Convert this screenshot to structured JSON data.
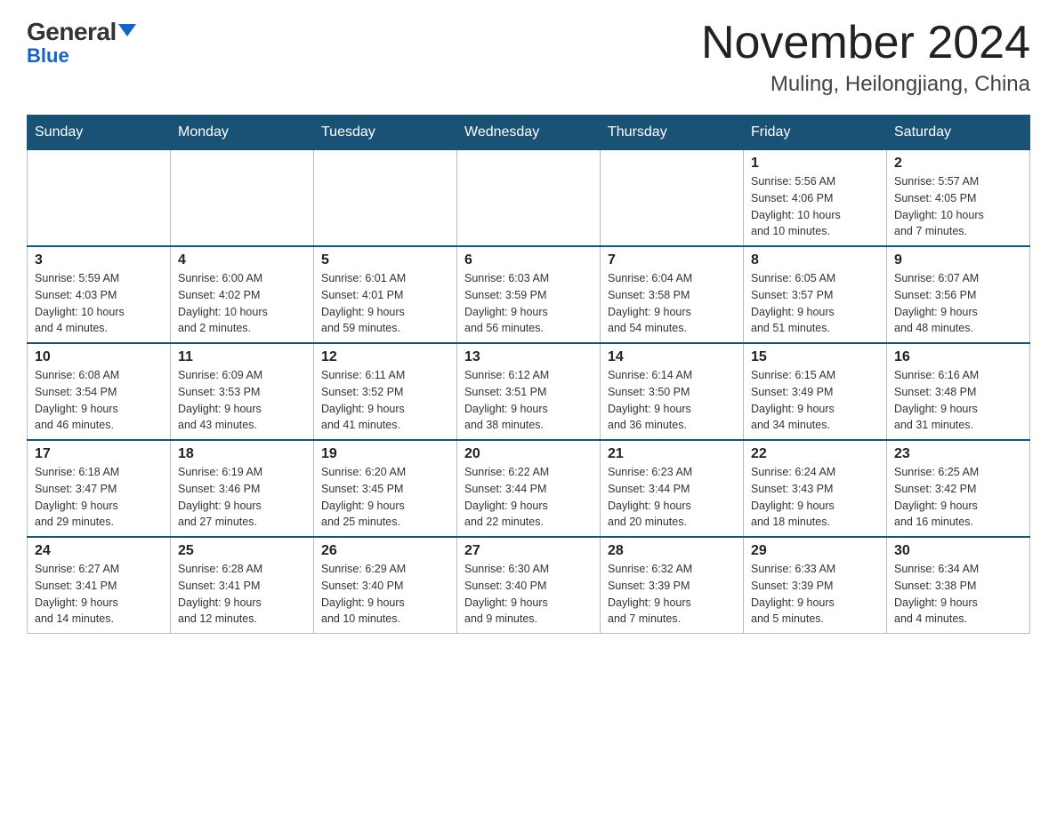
{
  "header": {
    "logo_top": "General",
    "logo_bottom": "Blue",
    "title": "November 2024",
    "subtitle": "Muling, Heilongjiang, China"
  },
  "weekdays": [
    "Sunday",
    "Monday",
    "Tuesday",
    "Wednesday",
    "Thursday",
    "Friday",
    "Saturday"
  ],
  "weeks": [
    [
      {
        "day": "",
        "info": ""
      },
      {
        "day": "",
        "info": ""
      },
      {
        "day": "",
        "info": ""
      },
      {
        "day": "",
        "info": ""
      },
      {
        "day": "",
        "info": ""
      },
      {
        "day": "1",
        "info": "Sunrise: 5:56 AM\nSunset: 4:06 PM\nDaylight: 10 hours\nand 10 minutes."
      },
      {
        "day": "2",
        "info": "Sunrise: 5:57 AM\nSunset: 4:05 PM\nDaylight: 10 hours\nand 7 minutes."
      }
    ],
    [
      {
        "day": "3",
        "info": "Sunrise: 5:59 AM\nSunset: 4:03 PM\nDaylight: 10 hours\nand 4 minutes."
      },
      {
        "day": "4",
        "info": "Sunrise: 6:00 AM\nSunset: 4:02 PM\nDaylight: 10 hours\nand 2 minutes."
      },
      {
        "day": "5",
        "info": "Sunrise: 6:01 AM\nSunset: 4:01 PM\nDaylight: 9 hours\nand 59 minutes."
      },
      {
        "day": "6",
        "info": "Sunrise: 6:03 AM\nSunset: 3:59 PM\nDaylight: 9 hours\nand 56 minutes."
      },
      {
        "day": "7",
        "info": "Sunrise: 6:04 AM\nSunset: 3:58 PM\nDaylight: 9 hours\nand 54 minutes."
      },
      {
        "day": "8",
        "info": "Sunrise: 6:05 AM\nSunset: 3:57 PM\nDaylight: 9 hours\nand 51 minutes."
      },
      {
        "day": "9",
        "info": "Sunrise: 6:07 AM\nSunset: 3:56 PM\nDaylight: 9 hours\nand 48 minutes."
      }
    ],
    [
      {
        "day": "10",
        "info": "Sunrise: 6:08 AM\nSunset: 3:54 PM\nDaylight: 9 hours\nand 46 minutes."
      },
      {
        "day": "11",
        "info": "Sunrise: 6:09 AM\nSunset: 3:53 PM\nDaylight: 9 hours\nand 43 minutes."
      },
      {
        "day": "12",
        "info": "Sunrise: 6:11 AM\nSunset: 3:52 PM\nDaylight: 9 hours\nand 41 minutes."
      },
      {
        "day": "13",
        "info": "Sunrise: 6:12 AM\nSunset: 3:51 PM\nDaylight: 9 hours\nand 38 minutes."
      },
      {
        "day": "14",
        "info": "Sunrise: 6:14 AM\nSunset: 3:50 PM\nDaylight: 9 hours\nand 36 minutes."
      },
      {
        "day": "15",
        "info": "Sunrise: 6:15 AM\nSunset: 3:49 PM\nDaylight: 9 hours\nand 34 minutes."
      },
      {
        "day": "16",
        "info": "Sunrise: 6:16 AM\nSunset: 3:48 PM\nDaylight: 9 hours\nand 31 minutes."
      }
    ],
    [
      {
        "day": "17",
        "info": "Sunrise: 6:18 AM\nSunset: 3:47 PM\nDaylight: 9 hours\nand 29 minutes."
      },
      {
        "day": "18",
        "info": "Sunrise: 6:19 AM\nSunset: 3:46 PM\nDaylight: 9 hours\nand 27 minutes."
      },
      {
        "day": "19",
        "info": "Sunrise: 6:20 AM\nSunset: 3:45 PM\nDaylight: 9 hours\nand 25 minutes."
      },
      {
        "day": "20",
        "info": "Sunrise: 6:22 AM\nSunset: 3:44 PM\nDaylight: 9 hours\nand 22 minutes."
      },
      {
        "day": "21",
        "info": "Sunrise: 6:23 AM\nSunset: 3:44 PM\nDaylight: 9 hours\nand 20 minutes."
      },
      {
        "day": "22",
        "info": "Sunrise: 6:24 AM\nSunset: 3:43 PM\nDaylight: 9 hours\nand 18 minutes."
      },
      {
        "day": "23",
        "info": "Sunrise: 6:25 AM\nSunset: 3:42 PM\nDaylight: 9 hours\nand 16 minutes."
      }
    ],
    [
      {
        "day": "24",
        "info": "Sunrise: 6:27 AM\nSunset: 3:41 PM\nDaylight: 9 hours\nand 14 minutes."
      },
      {
        "day": "25",
        "info": "Sunrise: 6:28 AM\nSunset: 3:41 PM\nDaylight: 9 hours\nand 12 minutes."
      },
      {
        "day": "26",
        "info": "Sunrise: 6:29 AM\nSunset: 3:40 PM\nDaylight: 9 hours\nand 10 minutes."
      },
      {
        "day": "27",
        "info": "Sunrise: 6:30 AM\nSunset: 3:40 PM\nDaylight: 9 hours\nand 9 minutes."
      },
      {
        "day": "28",
        "info": "Sunrise: 6:32 AM\nSunset: 3:39 PM\nDaylight: 9 hours\nand 7 minutes."
      },
      {
        "day": "29",
        "info": "Sunrise: 6:33 AM\nSunset: 3:39 PM\nDaylight: 9 hours\nand 5 minutes."
      },
      {
        "day": "30",
        "info": "Sunrise: 6:34 AM\nSunset: 3:38 PM\nDaylight: 9 hours\nand 4 minutes."
      }
    ]
  ]
}
